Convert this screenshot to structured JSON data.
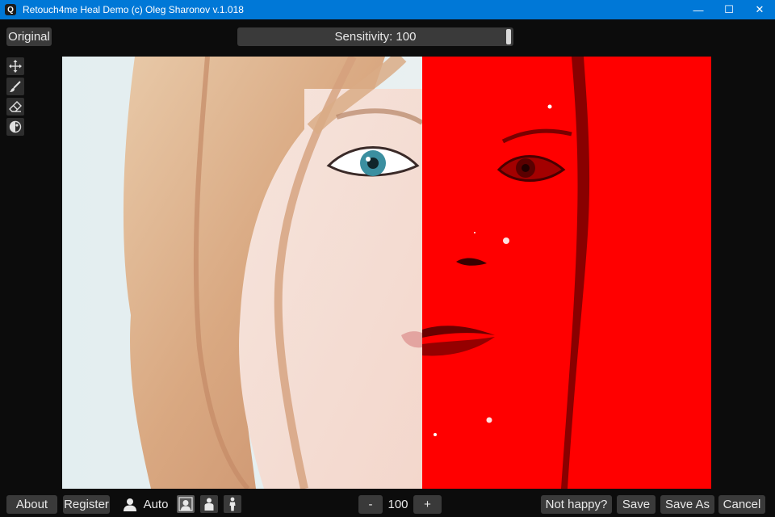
{
  "window": {
    "title": "Retouch4me Heal Demo (c) Oleg Sharonov v.1.018",
    "icon_letter": "Q",
    "minimize_symbol": "—",
    "maximize_symbol": "☐",
    "close_symbol": "✕"
  },
  "toolbar": {
    "original_label": "Original",
    "sensitivity_text": "Sensitivity: 100",
    "sensitivity_value": 100
  },
  "tools": [
    {
      "name": "move",
      "icon": "move-icon"
    },
    {
      "name": "brush",
      "icon": "brush-icon"
    },
    {
      "name": "eraser",
      "icon": "eraser-icon"
    },
    {
      "name": "mask",
      "icon": "mask-icon"
    }
  ],
  "canvas": {
    "overlay_color": "#ff0000"
  },
  "bottom": {
    "about_label": "About",
    "register_label": "Register",
    "auto_label": "Auto",
    "minus_label": "-",
    "value": "100",
    "plus_label": "+",
    "not_happy_label": "Not happy?",
    "save_label": "Save",
    "save_as_label": "Save As",
    "cancel_label": "Cancel"
  },
  "colors": {
    "titlebar": "#0078d7",
    "background": "#0c0c0c",
    "button": "#3a3a3a"
  }
}
